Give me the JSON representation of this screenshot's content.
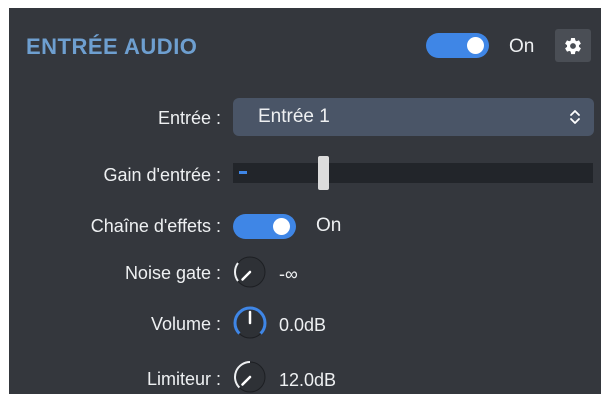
{
  "header": {
    "title": "ENTRÉE AUDIO",
    "toggle_state": "On",
    "settings_icon": "gear-icon"
  },
  "rows": {
    "input": {
      "label": "Entrée :",
      "value": "Entrée 1"
    },
    "gain": {
      "label": "Gain d'entrée :",
      "level": 0.25
    },
    "effects": {
      "label": "Chaîne d'effets :",
      "state": "On"
    },
    "noise_gate": {
      "label": "Noise gate :",
      "value": "-∞"
    },
    "volume": {
      "label": "Volume :",
      "value": "0.0dB"
    },
    "limiter": {
      "label": "Limiteur :",
      "value": "12.0dB"
    }
  },
  "colors": {
    "panel_bg": "#34373d",
    "accent": "#3f86e6",
    "title": "#6e9fd0",
    "select_bg": "#4a5567"
  }
}
